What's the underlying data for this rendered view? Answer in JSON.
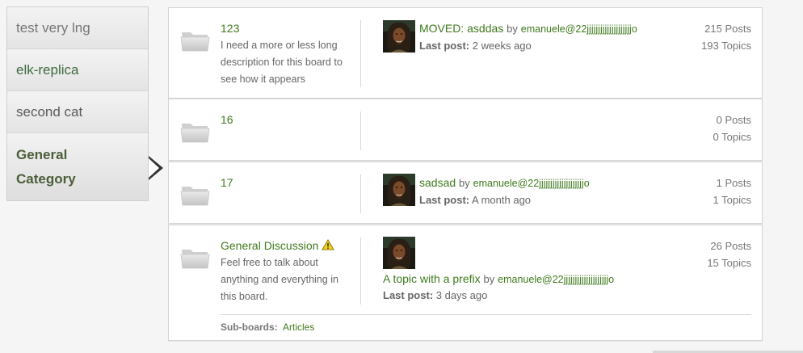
{
  "sidebar": {
    "categories": [
      {
        "label": "test very lng"
      },
      {
        "label": "elk-replica"
      },
      {
        "label": "second cat"
      },
      {
        "label_line1": "General",
        "label_line2": "Category"
      }
    ]
  },
  "boards": [
    {
      "name": "123",
      "description": "I need a more or less long description for this board to see how it appears",
      "last_post": {
        "title": "MOVED: asddas",
        "by": "by",
        "user": "emanuele@22jjjjjjjjjjjjjjjjjjjjo",
        "label": "Last post:",
        "time": "2 weeks ago"
      },
      "posts": "215 Posts",
      "topics": "193 Topics"
    },
    {
      "name": "16",
      "posts": "0 Posts",
      "topics": "0 Topics"
    },
    {
      "name": "17",
      "last_post": {
        "title": "sadsad",
        "by": "by",
        "user": "emanuele@22jjjjjjjjjjjjjjjjjjjjo",
        "label": "Last post:",
        "time": "A month ago"
      },
      "posts": "1 Posts",
      "topics": "1 Topics"
    },
    {
      "name": "General Discussion",
      "description": "Feel free to talk about anything and everything in this board.",
      "last_post": {
        "title": "A topic with a prefix",
        "by": "by",
        "user": "emanuele@22jjjjjjjjjjjjjjjjjjjjo",
        "label": "Last post:",
        "time": "3 days ago"
      },
      "posts": "26 Posts",
      "topics": "15 Topics",
      "subboards_label": "Sub-boards:",
      "subboards": [
        "Articles"
      ]
    }
  ],
  "icons": {
    "board": "folder-icon",
    "warning": "warning-icon",
    "avatar": "user-avatar"
  },
  "colors": {
    "link": "#3f7a1e",
    "text": "#666666",
    "active_category": "#4a5e3a"
  }
}
